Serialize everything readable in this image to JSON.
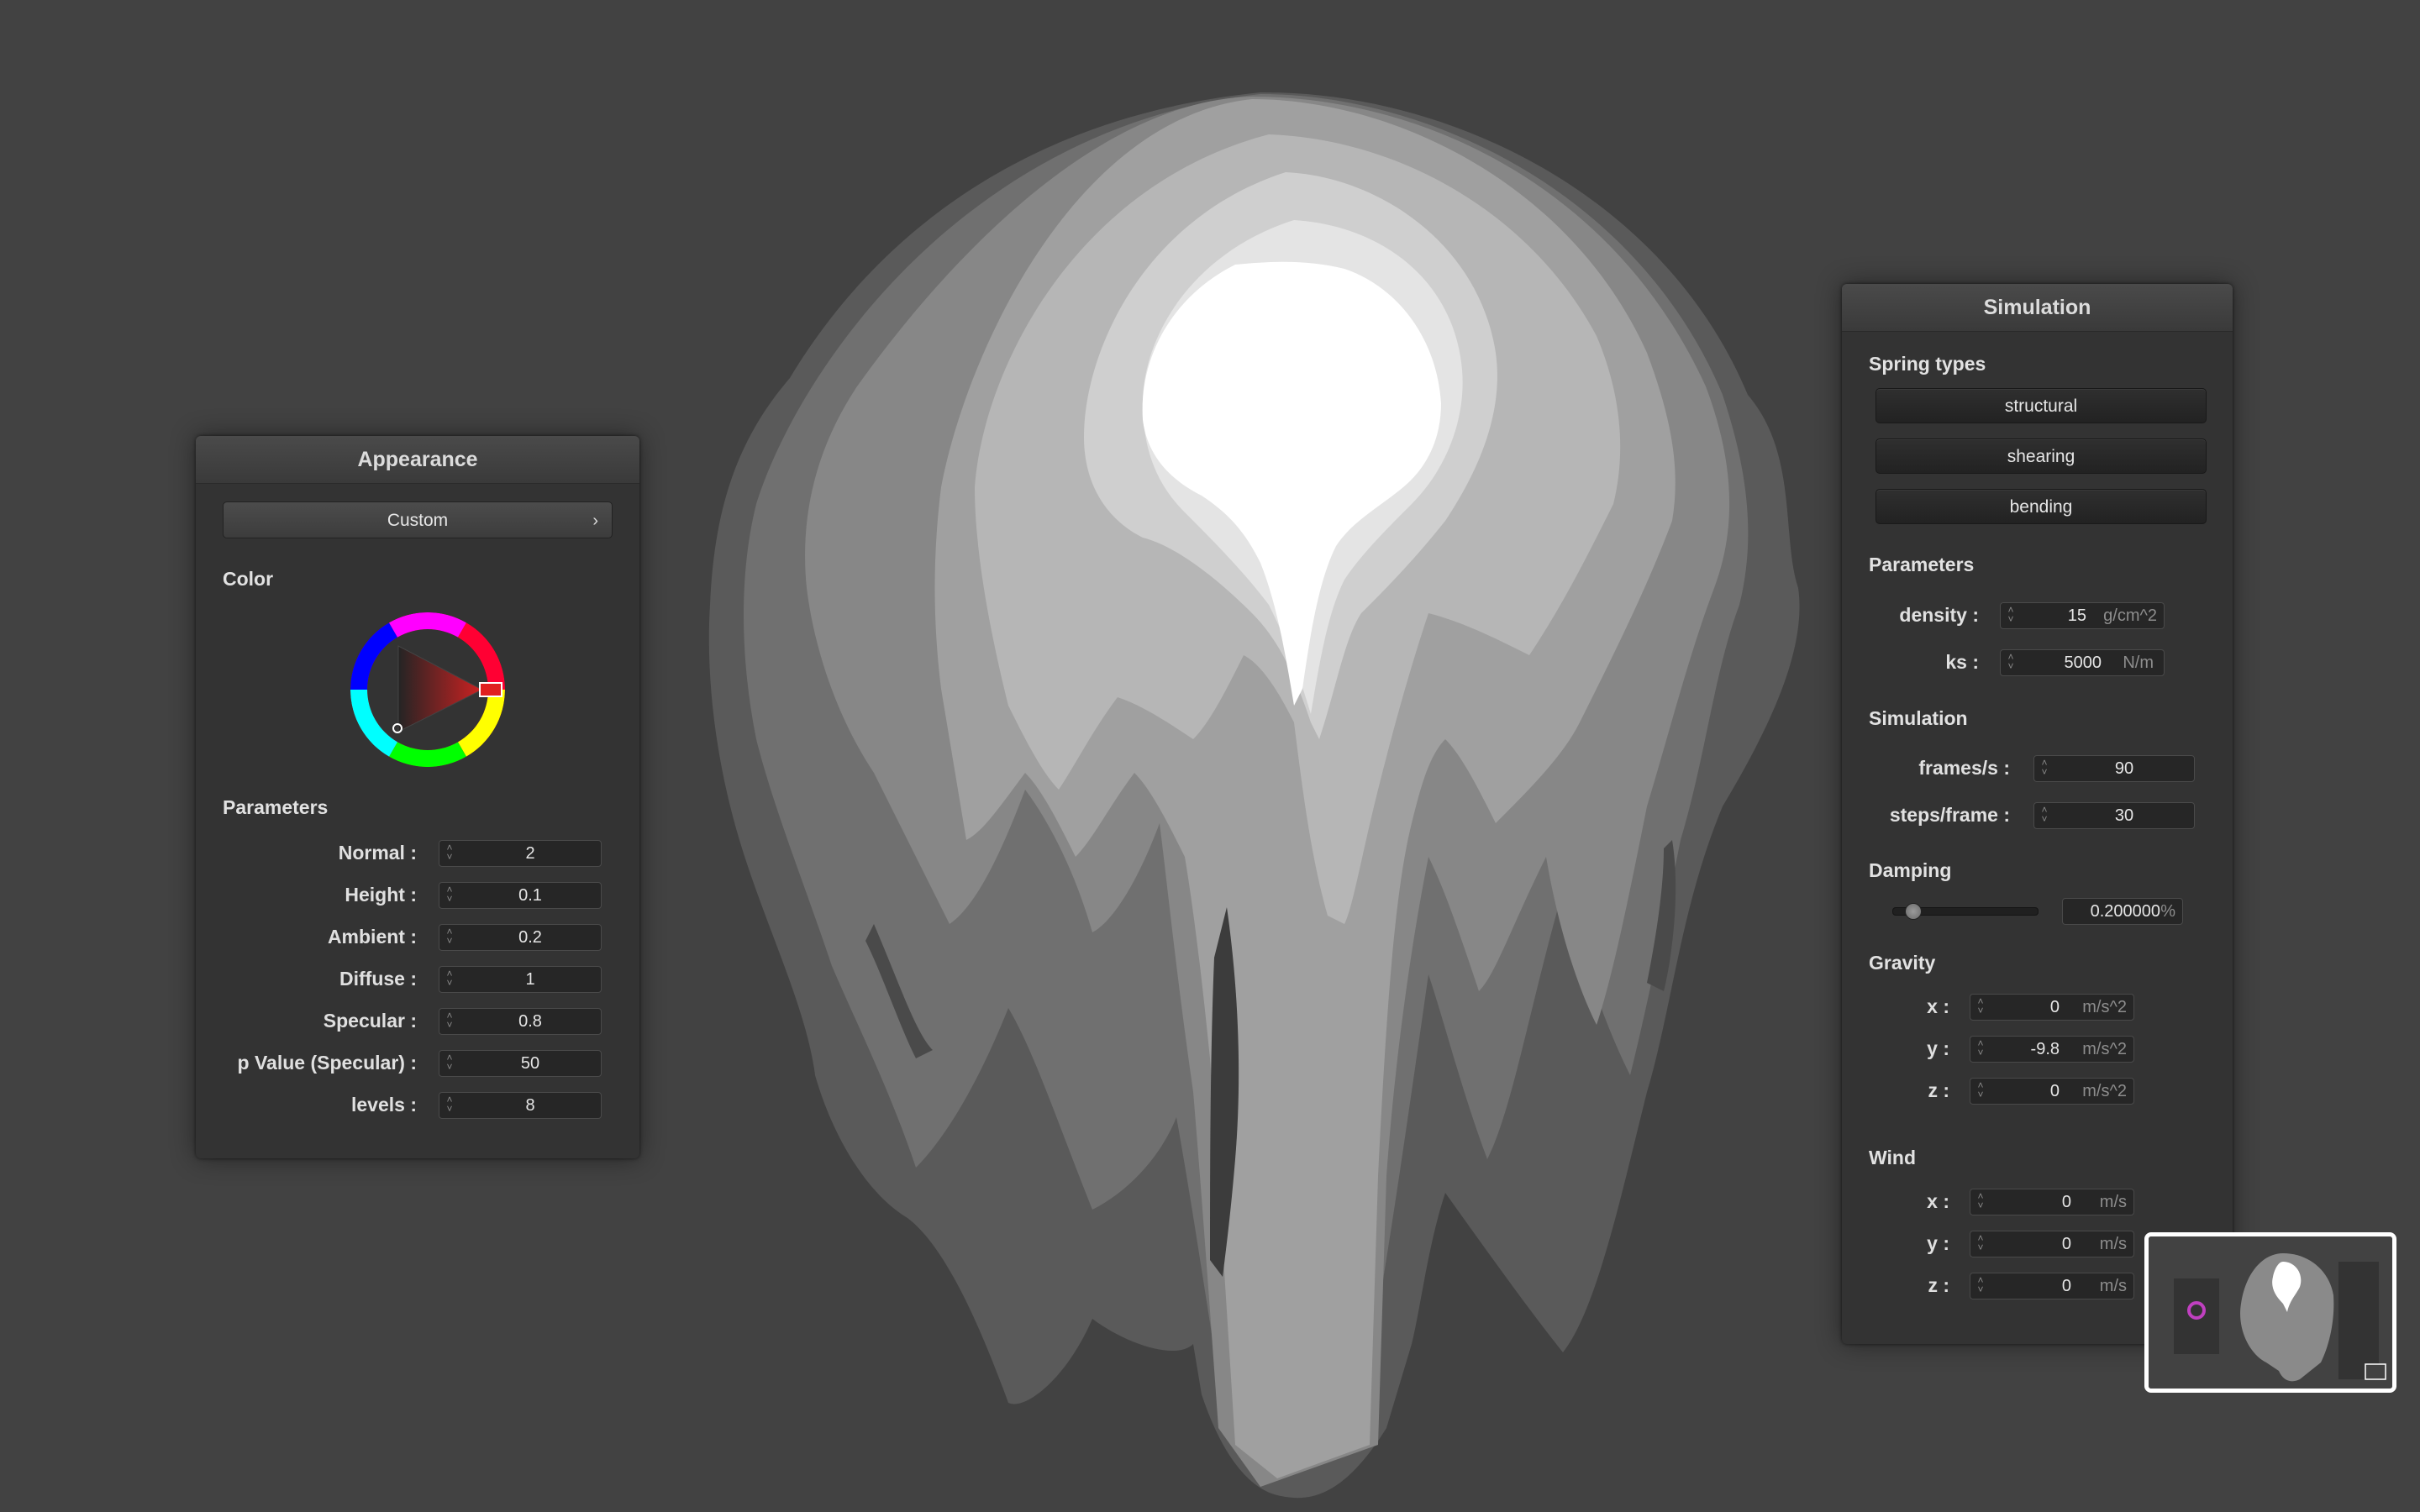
{
  "appearance": {
    "title": "Appearance",
    "preset": "Custom",
    "color_label": "Color",
    "parameters_label": "Parameters",
    "fields": [
      {
        "label": "Normal :",
        "value": "2"
      },
      {
        "label": "Height :",
        "value": "0.1"
      },
      {
        "label": "Ambient :",
        "value": "0.2"
      },
      {
        "label": "Diffuse :",
        "value": "1"
      },
      {
        "label": "Specular :",
        "value": "0.8"
      },
      {
        "label": "p Value (Specular) :",
        "value": "50"
      },
      {
        "label": "levels :",
        "value": "8"
      }
    ],
    "selected_color": "#e02020"
  },
  "simulation": {
    "title": "Simulation",
    "spring_types_label": "Spring types",
    "spring_buttons": [
      "structural",
      "shearing",
      "bending"
    ],
    "parameters_label": "Parameters",
    "density": {
      "label": "density :",
      "value": "15",
      "unit": "g/cm^2"
    },
    "ks": {
      "label": "ks :",
      "value": "5000",
      "unit": "N/m"
    },
    "simulation_label": "Simulation",
    "fps": {
      "label": "frames/s :",
      "value": "90"
    },
    "steps": {
      "label": "steps/frame :",
      "value": "30"
    },
    "damping_label": "Damping",
    "damping": {
      "value": "0.200000",
      "unit": "%",
      "slider_fraction": 0.2
    },
    "gravity_label": "Gravity",
    "gravity": [
      {
        "label": "x :",
        "value": "0",
        "unit": "m/s^2"
      },
      {
        "label": "y :",
        "value": "-9.8",
        "unit": "m/s^2"
      },
      {
        "label": "z :",
        "value": "0",
        "unit": "m/s^2"
      }
    ],
    "wind_label": "Wind",
    "wind": [
      {
        "label": "x :",
        "value": "0",
        "unit": "m/s"
      },
      {
        "label": "y :",
        "value": "0",
        "unit": "m/s"
      },
      {
        "label": "z :",
        "value": "0",
        "unit": "m/s"
      }
    ]
  },
  "colors": {
    "background": "#424242",
    "panel": "#333333",
    "cloth_levels": [
      "#555555",
      "#6a6a6a",
      "#808080",
      "#999999",
      "#b4b4b4",
      "#cfcfcf",
      "#e6e6e6",
      "#ffffff"
    ]
  }
}
